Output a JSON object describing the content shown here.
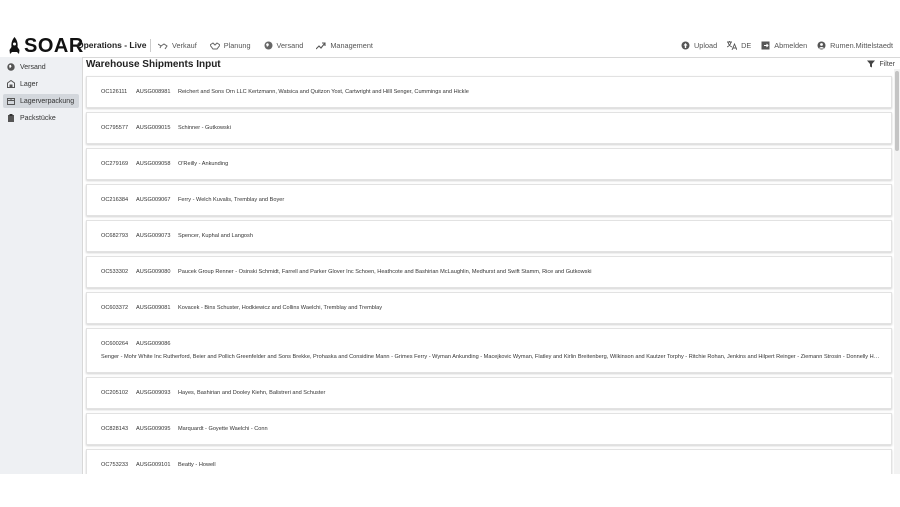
{
  "header": {
    "logo_text": "SOAR",
    "app_title": "Operations - Live",
    "nav": [
      {
        "label": "Verkauf",
        "icon": "truck-icon"
      },
      {
        "label": "Planung",
        "icon": "handshake-icon"
      },
      {
        "label": "Versand",
        "icon": "globe-icon"
      },
      {
        "label": "Management",
        "icon": "trend-icon"
      }
    ],
    "upload_label": "Upload",
    "language_label": "DE",
    "logout_label": "Abmelden",
    "user_name": "Rumen.Mittelstaedt"
  },
  "sidebar": {
    "items": [
      {
        "label": "Versand",
        "icon": "globe-icon",
        "active": false
      },
      {
        "label": "Lager",
        "icon": "warehouse-icon",
        "active": false
      },
      {
        "label": "Lagerverpackung",
        "icon": "package-icon",
        "active": true
      },
      {
        "label": "Packstücke",
        "icon": "clipboard-icon",
        "active": false
      }
    ]
  },
  "main": {
    "title": "Warehouse Shipments Input",
    "filter_label": "Filter",
    "rows": [
      {
        "order": "OC126111",
        "shipment": "AUSG008981",
        "customer": "Reichert and Sons Orn LLC Kertzmann, Watsica and Quitzon Yost, Cartwright and Hilll Senger, Cummings and Hickle"
      },
      {
        "order": "OC795577",
        "shipment": "AUSG009015",
        "customer": "Schinner - Gutkowski"
      },
      {
        "order": "OC279169",
        "shipment": "AUSG009058",
        "customer": "O'Reilly - Ankunding"
      },
      {
        "order": "OC216384",
        "shipment": "AUSG009067",
        "customer": "Ferry - Welch Kuvalis, Tremblay and Boyer"
      },
      {
        "order": "OC682793",
        "shipment": "AUSG009073",
        "customer": "Spencer, Kuphal and Langosh"
      },
      {
        "order": "OC533302",
        "shipment": "AUSG009080",
        "customer": "Paucek Group Renner - Osinski Schmidt, Farrell and Parker Glover Inc Schoen, Heathcote and Bashirian McLaughlin, Medhurst and Swift Stamm, Rice and Gutkowski"
      },
      {
        "order": "OC603372",
        "shipment": "AUSG009081",
        "customer": "Kovacek - Bins Schuster, Hodkiewicz and Collins Waelchi, Tremblay and Tremblay"
      },
      {
        "order": "OC600264",
        "shipment": "AUSG009086",
        "customer": "Senger - Mohr White Inc Rutherford, Beier and Pollich Greenfelder and Sons Brekke, Prohaska and Considine Mann - Grimes Ferry - Wyman Ankunding - Macejkovic Wyman, Flatley and Kirlin Breitenberg, Wilkinson and Kautzer Torphy - Ritchie Rohan, Jenkins and Hilpert Reinger - Ziemann Strosin - Donnelly Hetti...",
        "tall": true
      },
      {
        "order": "OC205102",
        "shipment": "AUSG009093",
        "customer": "Hayes, Bashirian and Dooley Kiehn, Balistreri and Schuster"
      },
      {
        "order": "OC828143",
        "shipment": "AUSG009095",
        "customer": "Marquardt - Goyette Waelchi - Conn"
      },
      {
        "order": "OC753233",
        "shipment": "AUSG009101",
        "customer": "Beatty - Howell"
      }
    ]
  }
}
